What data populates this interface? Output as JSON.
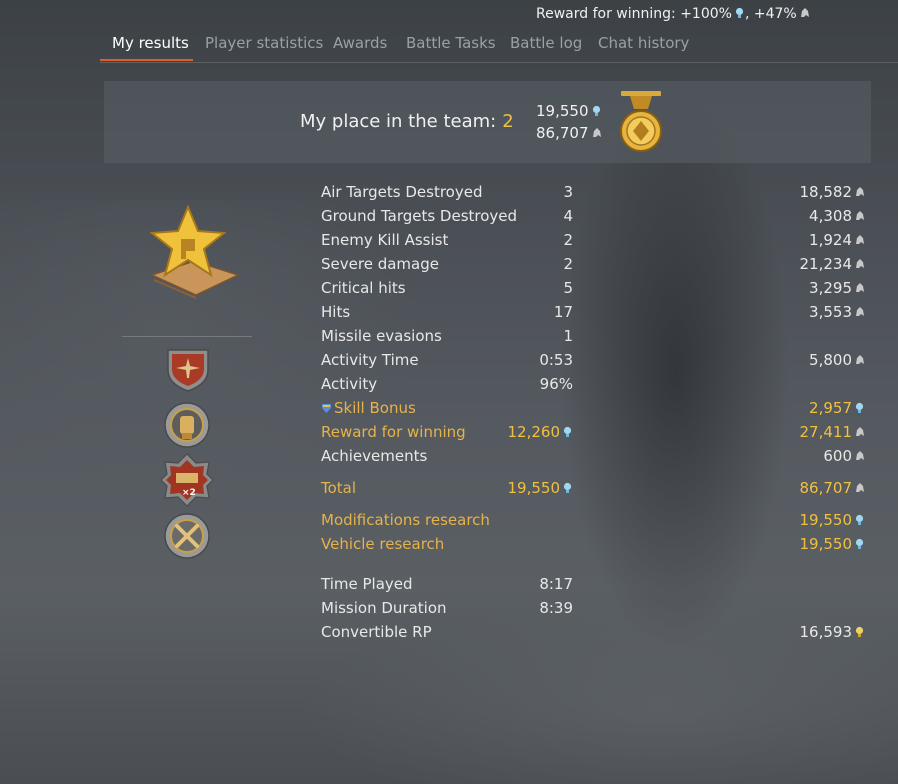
{
  "header": {
    "reward_text": "Reward for winning: +100%",
    "reward_sep": ", +47%"
  },
  "tabs": [
    {
      "label": "My results",
      "active": true
    },
    {
      "label": "Player statistics"
    },
    {
      "label": "Awards"
    },
    {
      "label": "Battle Tasks"
    },
    {
      "label": "Battle log"
    },
    {
      "label": "Chat history"
    }
  ],
  "banner": {
    "place_label": "My place in the team:",
    "place_value": "2",
    "rp": "19,550",
    "sl": "86,707"
  },
  "stats": [
    {
      "label": "Air Targets Destroyed",
      "v1": "3",
      "v2": "18,582",
      "i2": "sl"
    },
    {
      "label": "Ground Targets Destroyed",
      "v1": "4",
      "v2": "4,308",
      "i2": "sl"
    },
    {
      "label": "Enemy Kill Assist",
      "v1": "2",
      "v2": "1,924",
      "i2": "sl"
    },
    {
      "label": "Severe damage",
      "v1": "2",
      "v2": "21,234",
      "i2": "sl"
    },
    {
      "label": "Critical hits",
      "v1": "5",
      "v2": "3,295",
      "i2": "sl"
    },
    {
      "label": "Hits",
      "v1": "17",
      "v2": "3,553",
      "i2": "sl"
    },
    {
      "label": "Missile evasions",
      "v1": "1",
      "v2": ""
    },
    {
      "label": "Activity Time",
      "v1": "0:53",
      "v2": "5,800",
      "i2": "sl"
    },
    {
      "label": "Activity",
      "v1": "96%",
      "v2": ""
    },
    {
      "label": "Skill Bonus",
      "v1": "",
      "v2": "2,957",
      "i2": "rp",
      "gold": true,
      "pre_icon": true
    },
    {
      "label": "Reward for winning",
      "v1": "12,260",
      "i1": "rp",
      "v2": "27,411",
      "i2": "sl",
      "gold": true
    },
    {
      "label": "Achievements",
      "v1": "",
      "v2": "600",
      "i2": "sl"
    },
    {
      "label": "Total",
      "v1": "19,550",
      "i1": "rp",
      "v2": "86,707",
      "i2": "sl",
      "gold": true
    },
    {
      "label": "Modifications research",
      "v1": "",
      "v2": "19,550",
      "i2": "rp",
      "gold": true
    },
    {
      "label": "Vehicle research",
      "v1": "",
      "v2": "19,550",
      "i2": "rp",
      "gold": true
    },
    {
      "label": "Time Played",
      "v1": "8:17",
      "v2": ""
    },
    {
      "label": "Mission Duration",
      "v1": "8:39",
      "v2": ""
    },
    {
      "label": "Convertible RP",
      "v1": "",
      "v2": "16,593",
      "i2": "crp"
    }
  ],
  "colors": {
    "accent_tab": "#e05a2a",
    "gold_text": "#e6b24a",
    "gold_value": "#f0c040"
  }
}
